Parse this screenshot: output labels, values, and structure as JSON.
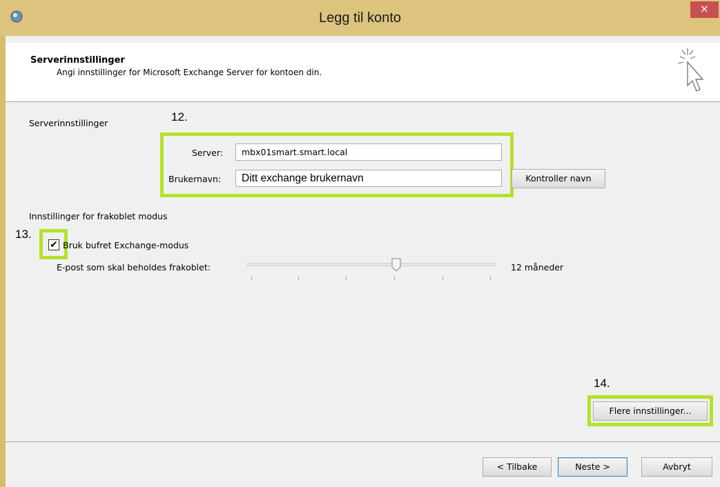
{
  "window": {
    "title": "Legg til konto",
    "close_glyph": "×"
  },
  "header": {
    "title": "Serverinnstillinger",
    "subtitle": "Angi innstillinger for Microsoft Exchange Server for kontoen din.",
    "icon": "cursor-sparkle-icon"
  },
  "server_section": {
    "label": "Serverinnstillinger",
    "step": "12.",
    "server_label": "Server:",
    "server_value": "mbx01smart.smart.local",
    "username_label": "Brukernavn:",
    "username_value": "Ditt exchange brukernavn",
    "check_name_button": "Kontroller navn"
  },
  "offline_section": {
    "label": "Innstillinger for frakoblet modus",
    "step": "13.",
    "cached_mode_label": "Bruk bufret Exchange-modus",
    "cached_mode_checked": true,
    "keep_offline_label": "E-post som skal beholdes frakoblet:",
    "keep_offline_value": "12 måneder",
    "slider_level": 0.6
  },
  "more": {
    "step": "14.",
    "button": "Flere innstillinger..."
  },
  "footer": {
    "back": "< Tilbake",
    "next": "Neste >",
    "cancel": "Avbryt"
  },
  "colors": {
    "highlight": "#b4e22a",
    "titlebar": "#dcc47e",
    "close": "#c75050"
  }
}
